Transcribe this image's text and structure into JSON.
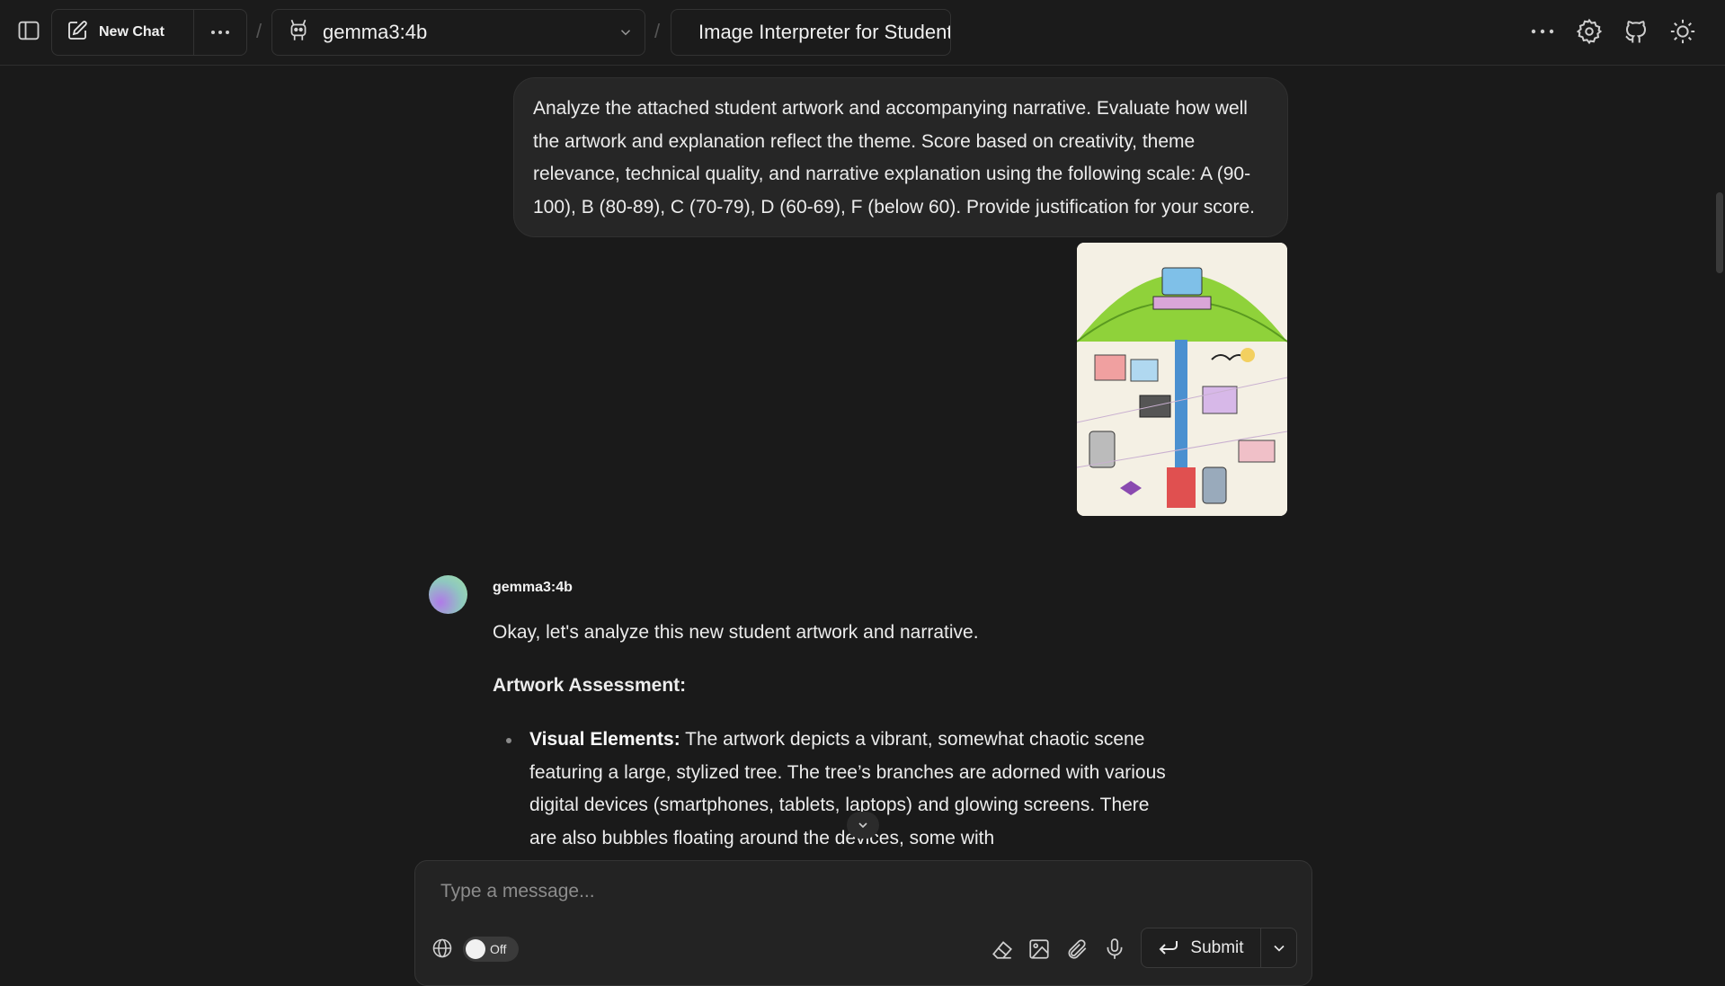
{
  "header": {
    "new_chat_label": "New Chat",
    "breadcrumb_separator": "/",
    "model_name": "gemma3:4b",
    "chat_title": "Image Interpreter for Student"
  },
  "messages": {
    "user_text": "Analyze the attached student artwork and accompanying narrative. Evaluate how well the artwork and explanation reflect the theme. Score based on creativity, theme relevance, technical quality, and narrative explanation using the following scale: A (90-100), B (80-89), C (70-79), D (60-69), F (below 60). Provide justification for your score.",
    "assistant_name": "gemma3:4b",
    "assistant_intro": "Okay, let's analyze this new student artwork and narrative.",
    "assistant_heading": "Artwork Assessment:",
    "assistant_bullet_label": "Visual Elements:",
    "assistant_bullet_text": " The artwork depicts a vibrant, somewhat chaotic scene featuring a large, stylized tree. The tree’s branches are adorned with various digital devices (smartphones, tablets, laptops) and glowing screens. There are also bubbles floating around the devices, some with"
  },
  "composer": {
    "placeholder": "Type a message...",
    "toggle_label": "Off",
    "submit_label": "Submit"
  },
  "icons": {
    "sidebar": "sidebar-toggle-icon",
    "new_chat": "edit-icon",
    "more": "more-horizontal-icon",
    "model": "robot-icon",
    "settings": "settings-icon",
    "github": "github-icon",
    "theme": "sun-icon"
  },
  "colors": {
    "background": "#1a1a1a",
    "bubble": "#262626",
    "avatar_from": "#b07ae8",
    "avatar_to": "#9ee0a4"
  }
}
